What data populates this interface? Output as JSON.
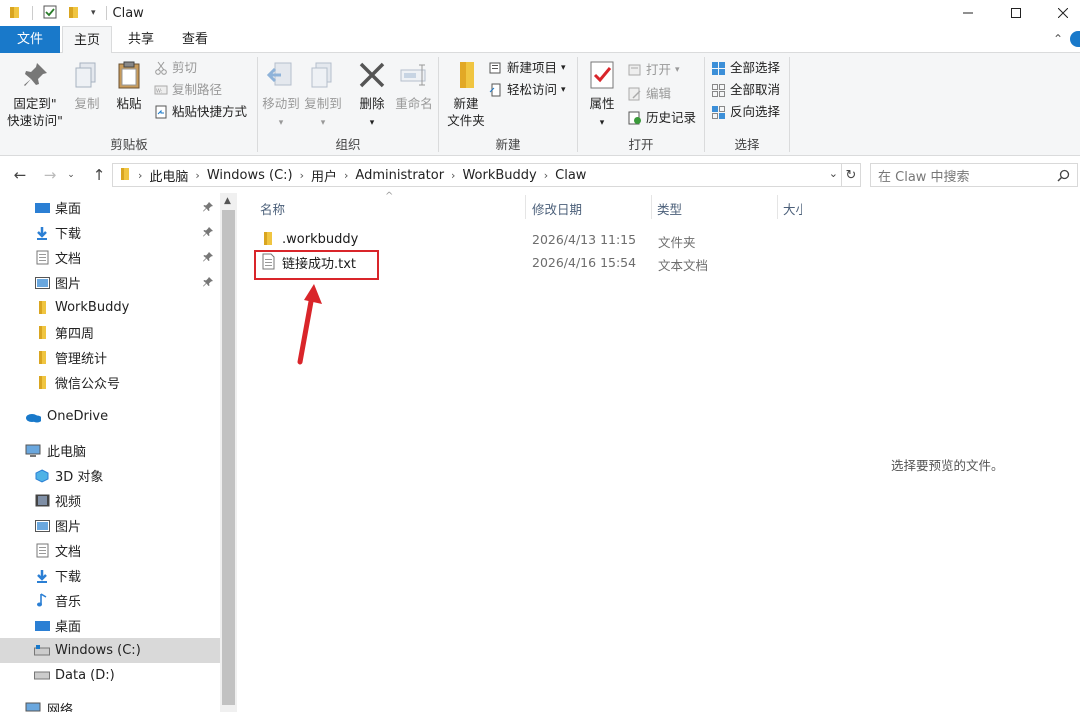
{
  "window": {
    "title": "Claw"
  },
  "tabs": {
    "file": "文件",
    "home": "主页",
    "share": "共享",
    "view": "查看"
  },
  "ribbon": {
    "clipboard": {
      "label": "剪贴板",
      "pin_line1": "固定到\"",
      "pin_line2": "快速访问\"",
      "copy": "复制",
      "paste": "粘贴",
      "cut": "剪切",
      "copy_path": "复制路径",
      "paste_shortcut": "粘贴快捷方式"
    },
    "organize": {
      "label": "组织",
      "move_to": "移动到",
      "copy_to": "复制到",
      "delete": "删除",
      "rename": "重命名"
    },
    "new": {
      "label": "新建",
      "new_folder_line1": "新建",
      "new_folder_line2": "文件夹",
      "new_item": "新建项目",
      "easy_access": "轻松访问"
    },
    "open": {
      "label": "打开",
      "properties": "属性",
      "open": "打开",
      "edit": "编辑",
      "history": "历史记录"
    },
    "select": {
      "label": "选择",
      "select_all": "全部选择",
      "select_none": "全部取消",
      "invert": "反向选择"
    }
  },
  "address": {
    "crumbs": [
      "此电脑",
      "Windows (C:)",
      "用户",
      "Administrator",
      "WorkBuddy",
      "Claw"
    ]
  },
  "search": {
    "placeholder": "在 Claw 中搜索"
  },
  "nav": {
    "quick": [
      "桌面",
      "下载",
      "文档",
      "图片",
      "WorkBuddy",
      "第四周",
      "管理统计",
      "微信公众号"
    ],
    "onedrive": "OneDrive",
    "thispc": "此电脑",
    "pc_items": [
      "3D 对象",
      "视频",
      "图片",
      "文档",
      "下载",
      "音乐",
      "桌面",
      "Windows (C:)",
      "Data (D:)"
    ],
    "network": "网络"
  },
  "columns": {
    "name": "名称",
    "date": "修改日期",
    "type": "类型",
    "size": "大小"
  },
  "files": [
    {
      "name": ".workbuddy",
      "date": "2026/4/13 11:15",
      "type": "文件夹"
    },
    {
      "name": "链接成功.txt",
      "date": "2026/4/16 15:54",
      "type": "文本文档"
    }
  ],
  "preview": {
    "message": "选择要预览的文件。"
  },
  "colors": {
    "accent": "#1979ca",
    "highlight": "#d9252a",
    "folder": "#f0c541"
  }
}
